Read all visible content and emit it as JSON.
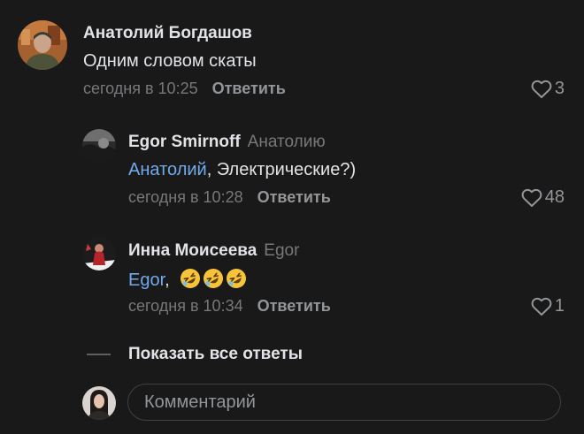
{
  "comments": [
    {
      "author": "Анатолий Богдашов",
      "reply_to": "",
      "mention": "",
      "text": "Одним словом скаты",
      "time": "сегодня в 10:25",
      "reply_label": "Ответить",
      "likes": "3",
      "avatar_icon": "avatar-photo-man-outdoor"
    },
    {
      "author": "Egor Smirnoff",
      "reply_to": "Анатолию",
      "mention": "Анатолий",
      "text": ", Электрические?)",
      "time": "сегодня в 10:28",
      "reply_label": "Ответить",
      "likes": "48",
      "avatar_icon": "avatar-photo-dark"
    },
    {
      "author": "Инна Моисеева",
      "reply_to": "Egor",
      "mention": "Egor",
      "text": ",",
      "emojis": [
        "rolling-on-floor-laughing",
        "rolling-on-floor-laughing",
        "rolling-on-floor-laughing"
      ],
      "time": "сегодня в 10:34",
      "reply_label": "Ответить",
      "likes": "1",
      "avatar_icon": "avatar-photo-woman-red"
    }
  ],
  "show_all_replies": "Показать все ответы",
  "composer": {
    "placeholder": "Комментарий",
    "avatar_icon": "avatar-photo-current-user"
  },
  "colors": {
    "background": "#19191a",
    "text": "#e1e3e6",
    "secondary": "#76787a",
    "link": "#71aaeb"
  }
}
